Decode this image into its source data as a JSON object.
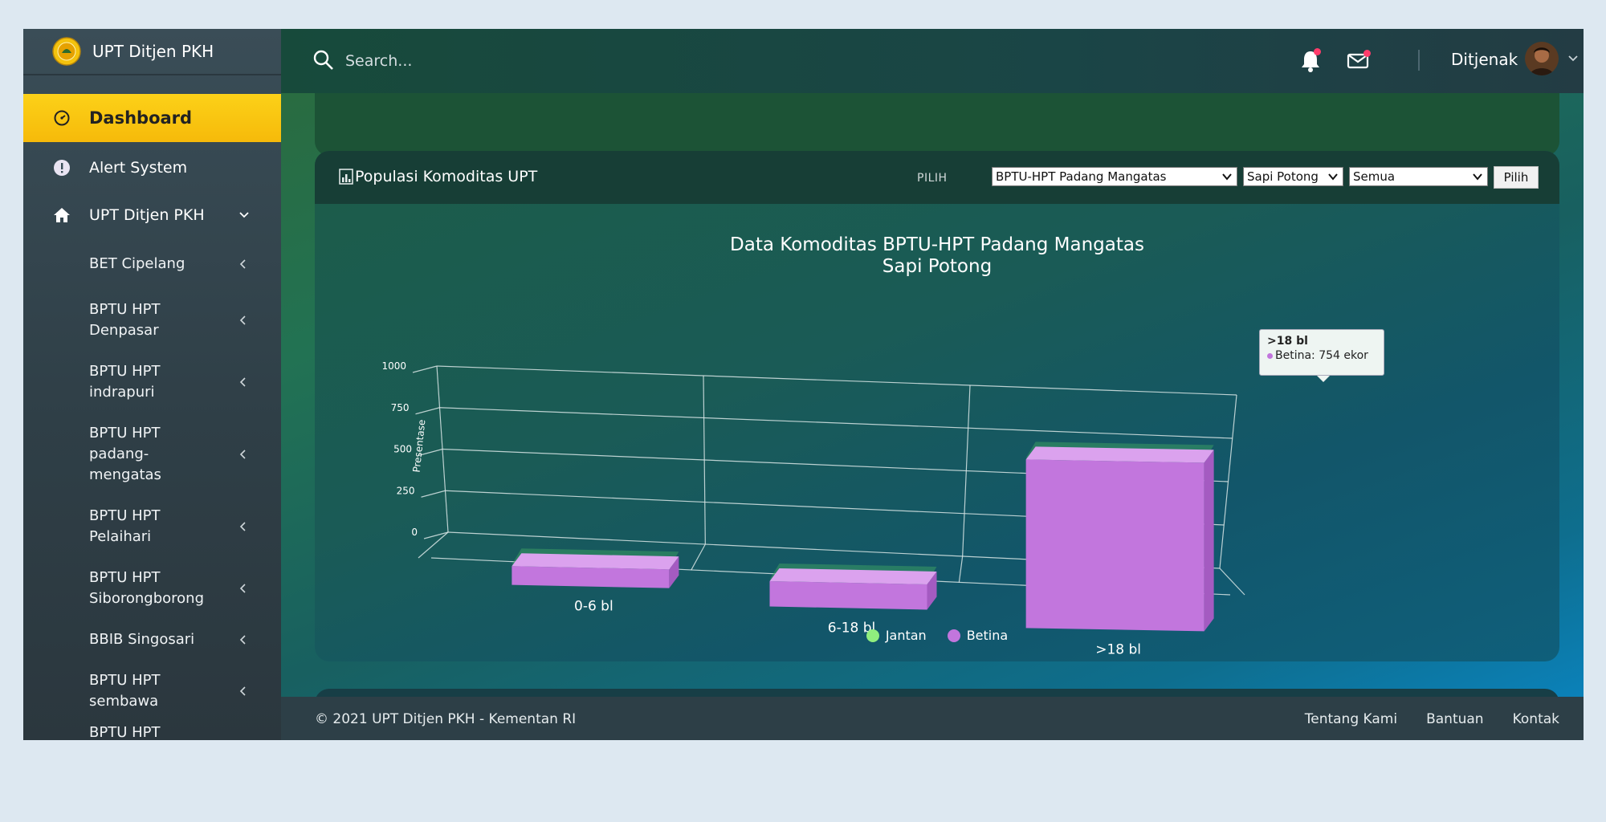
{
  "brand": {
    "name": "UPT Ditjen PKH"
  },
  "sidebar": {
    "items": [
      {
        "label": "Dashboard",
        "icon": "gauge-icon"
      },
      {
        "label": "Alert System",
        "icon": "alert-icon"
      },
      {
        "label": "UPT Ditjen PKH",
        "icon": "home-icon"
      }
    ],
    "subitems": [
      {
        "label": "BET Cipelang"
      },
      {
        "label": "BPTU HPT\nDenpasar"
      },
      {
        "label": "BPTU HPT\nindrapuri"
      },
      {
        "label": "BPTU HPT\npadang-\nmengatas"
      },
      {
        "label": "BPTU HPT\nPelaihari"
      },
      {
        "label": "BPTU HPT\nSiborongborong"
      },
      {
        "label": "BBIB Singosari"
      },
      {
        "label": "BPTU HPT\nsembawa"
      },
      {
        "label": "BPTU HPT"
      }
    ]
  },
  "topbar": {
    "search_placeholder": "Search...",
    "username": "Ditjenak"
  },
  "card": {
    "title": "Populasi Komoditas UPT",
    "pilih_label": "PILIH",
    "selects": {
      "upt": "BPTU-HPT Padang Mangatas",
      "komoditas": "Sapi Potong",
      "filter": "Semua"
    },
    "button_label": "Pilih"
  },
  "chart_data": {
    "type": "bar",
    "title": "Data Komoditas BPTU-HPT Padang Mangatas",
    "subtitle": "Sapi Potong",
    "ylabel": "Presentase",
    "ylim": [
      0,
      1000
    ],
    "yticks": [
      "0",
      "250",
      "500",
      "750",
      "1000"
    ],
    "categories": [
      "0-6 bl",
      "6-18 bl",
      ">18 bl"
    ],
    "series": [
      {
        "name": "Jantan",
        "color": "#90ee7e",
        "values": [
          0,
          0,
          0
        ]
      },
      {
        "name": "Betina",
        "color": "#c276dd",
        "values": [
          60,
          88,
          754
        ]
      }
    ],
    "tooltip": {
      "title": ">18 bl",
      "text": "Betina: 754 ekor"
    },
    "three_d": true,
    "grid": true,
    "legend_position": "bottom-center"
  },
  "footer": {
    "copyright": "© 2021 UPT Ditjen PKH - Kementan RI",
    "links": [
      "Tentang Kami",
      "Bantuan",
      "Kontak"
    ]
  }
}
